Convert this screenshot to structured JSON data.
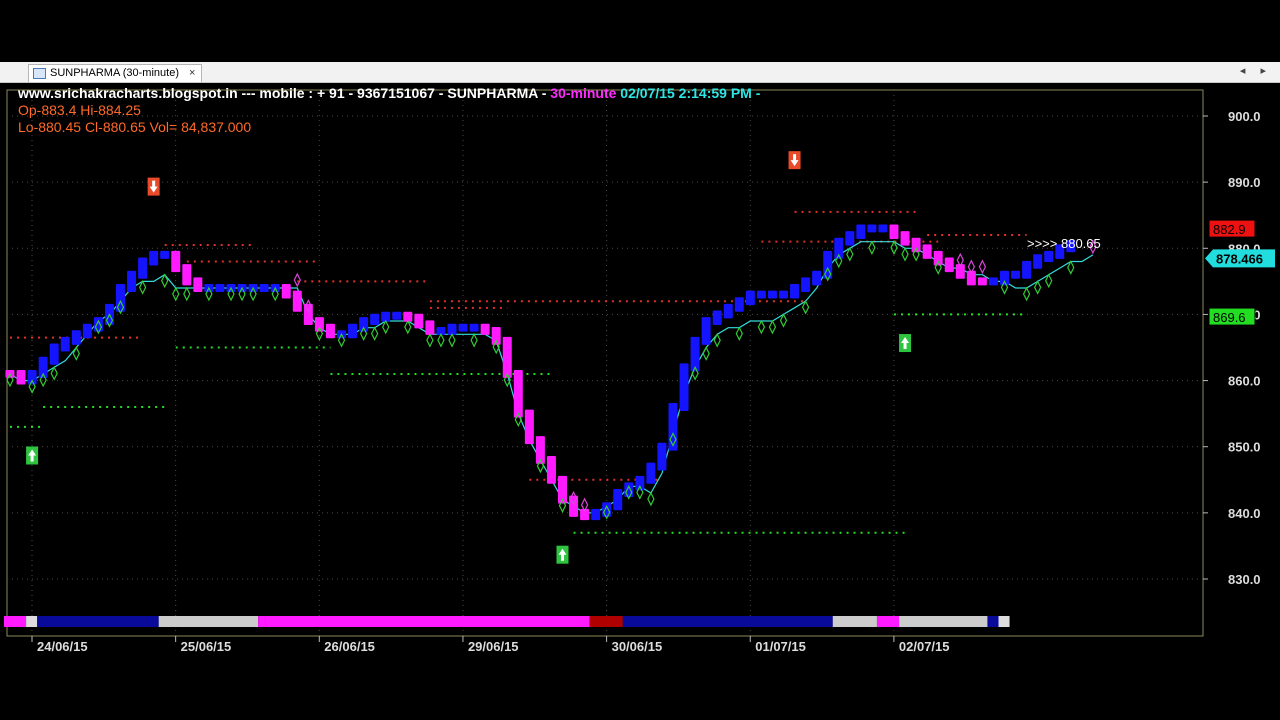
{
  "tab": {
    "title": "SUNPHARMA (30-minute)",
    "close": "×"
  },
  "nav": {
    "arrows": "◂ ▸"
  },
  "header": {
    "site": "www.srichakracharts.blogspot.in ---  mobile :  + 91 - 9367151067 - SUNPHARMA - ",
    "interval": "30-minute",
    "datetime": "  02/07/15 2:14:59 PM -",
    "ohl": "Op-883.4  Hi-884.25",
    "lcv": "Lo-880.45  Cl-880.65  Vol= 84,837.000"
  },
  "chart_data": {
    "type": "bar",
    "symbol": "SUNPHARMA",
    "interval": "30-minute",
    "y_ticks": [
      900.0,
      890.0,
      880.0,
      870.0,
      860.0,
      850.0,
      840.0,
      830.0
    ],
    "y_tick_labels": [
      "900.0",
      "890.0",
      "880.0",
      "870.0",
      "860.0",
      "850.0",
      "840.0",
      "830.0"
    ],
    "ylim": [
      823,
      904
    ],
    "x_labels": [
      "24/06/15",
      "25/06/15",
      "26/06/15",
      "29/06/15",
      "30/06/15",
      "01/07/15",
      "02/07/15"
    ],
    "bars_per_day": 13,
    "colors": {
      "up": "#1414ff",
      "down": "#ff1aff",
      "trail": "#33dddd",
      "resist": "#e0302a",
      "support": "#22dd22",
      "diamond_up": "#33cc33",
      "diamond_dn": "#dd44dd"
    },
    "closes": [
      861,
      860,
      861,
      863,
      865,
      866,
      867,
      868,
      869,
      871,
      874,
      876,
      878,
      879,
      879,
      877,
      875,
      874,
      874,
      874,
      874,
      874,
      874,
      874,
      874,
      873,
      871,
      869,
      868,
      867,
      867,
      868,
      869,
      869.5,
      869.8,
      869.8,
      869.5,
      868.5,
      867.5,
      867.5,
      868,
      868,
      868,
      867.5,
      866,
      861,
      855,
      851,
      848,
      845,
      842,
      840,
      839.5,
      840,
      841,
      843,
      844,
      845,
      847,
      850,
      856,
      862,
      866,
      869,
      870,
      871,
      872,
      873,
      873,
      873,
      873,
      874,
      875,
      876,
      879,
      881,
      882,
      883,
      883,
      883,
      882,
      881,
      880,
      879,
      878,
      877,
      876,
      875,
      875,
      875,
      876,
      876,
      877.5,
      878.5,
      879,
      880,
      880.65
    ],
    "trail_values": [
      861,
      860,
      860,
      861,
      862,
      863,
      865,
      867,
      869,
      870,
      872,
      874,
      875,
      875,
      876,
      874,
      874,
      874,
      874,
      874,
      874,
      874,
      874,
      874,
      874,
      874,
      874,
      870,
      868,
      867,
      867,
      867,
      868,
      868,
      869,
      869,
      869,
      868,
      867,
      867,
      867,
      867,
      867,
      867,
      866,
      861,
      855,
      851,
      848,
      845,
      842,
      841,
      840,
      840,
      841,
      842,
      844,
      844,
      843,
      846,
      852,
      858,
      862,
      865,
      867,
      868,
      868,
      869,
      869,
      869,
      870,
      871,
      872,
      874,
      877,
      879,
      880,
      881,
      881,
      881,
      881,
      880,
      880,
      879,
      878,
      877,
      877,
      876,
      876,
      875,
      875,
      874,
      874,
      875,
      876,
      877,
      878,
      878,
      879
    ],
    "resist_segments": [
      [
        0,
        12,
        866.5
      ],
      [
        14,
        22,
        880.5
      ],
      [
        16,
        28,
        878
      ],
      [
        26,
        38,
        875
      ],
      [
        38,
        45,
        871
      ],
      [
        38,
        72,
        872
      ],
      [
        47,
        59,
        845
      ],
      [
        68,
        84,
        881
      ],
      [
        71,
        82,
        885.5
      ],
      [
        83,
        92,
        882
      ]
    ],
    "support_segments": [
      [
        0,
        3,
        853
      ],
      [
        3,
        14,
        856
      ],
      [
        15,
        29,
        865
      ],
      [
        29,
        49,
        861
      ],
      [
        51,
        81,
        837
      ],
      [
        80,
        92,
        870
      ]
    ],
    "signals": [
      {
        "type": "buy",
        "index": 2,
        "value": 852
      },
      {
        "type": "sell",
        "index": 13,
        "value": 886
      },
      {
        "type": "buy",
        "index": 50,
        "value": 837
      },
      {
        "type": "sell",
        "index": 71,
        "value": 890
      },
      {
        "type": "buy",
        "index": 81,
        "value": 869
      }
    ],
    "last_price": "880.65",
    "last_price_label": ">>>>    880.65",
    "resist_label": "882.9",
    "trail_label": "878.466",
    "support_label": "869.6",
    "status_strip": [
      [
        "#ff1aff",
        0,
        2
      ],
      [
        "#dddddd",
        2,
        3
      ],
      [
        "#0a0a9a",
        3,
        14
      ],
      [
        "#cccccc",
        14,
        23
      ],
      [
        "#ff1aff",
        23,
        53
      ],
      [
        "#b00000",
        53,
        56
      ],
      [
        "#0a0a9a",
        56,
        75
      ],
      [
        "#cccccc",
        75,
        79
      ],
      [
        "#ff1aff",
        79,
        81
      ],
      [
        "#cccccc",
        81,
        89
      ],
      [
        "#0a0a9a",
        89,
        90
      ],
      [
        "#dddddd",
        90,
        91
      ]
    ]
  }
}
